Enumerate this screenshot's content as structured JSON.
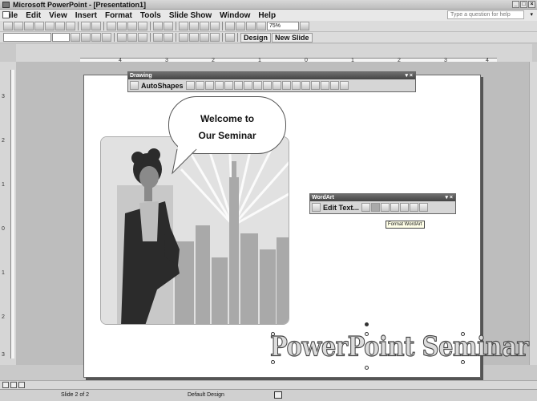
{
  "window": {
    "title": "Microsoft PowerPoint - [Presentation1]"
  },
  "menu": {
    "items": [
      "File",
      "Edit",
      "View",
      "Insert",
      "Format",
      "Tools",
      "Slide Show",
      "Window",
      "Help"
    ],
    "ask_placeholder": "Type a question for help"
  },
  "toolbar": {
    "zoom": "75%",
    "design_label": "Design",
    "new_slide_label": "New Slide"
  },
  "ruler": {
    "h": [
      "4",
      "3",
      "2",
      "1",
      "0",
      "1",
      "2",
      "3",
      "4"
    ],
    "v": [
      "3",
      "2",
      "1",
      "0",
      "1",
      "2",
      "3"
    ]
  },
  "drawing_toolbar": {
    "title": "Drawing",
    "autoshapes_label": "AutoShapes"
  },
  "slide": {
    "callout_lines": [
      "Welcome to",
      "Our Seminar"
    ],
    "wordart_text": "PowerPoint Seminar"
  },
  "wordart_toolbar": {
    "title": "WordArt",
    "edit_text_label": "Edit Text...",
    "tooltip": "Format WordArt"
  },
  "status": {
    "slide": "Slide 2 of 2",
    "design": "Default Design"
  }
}
